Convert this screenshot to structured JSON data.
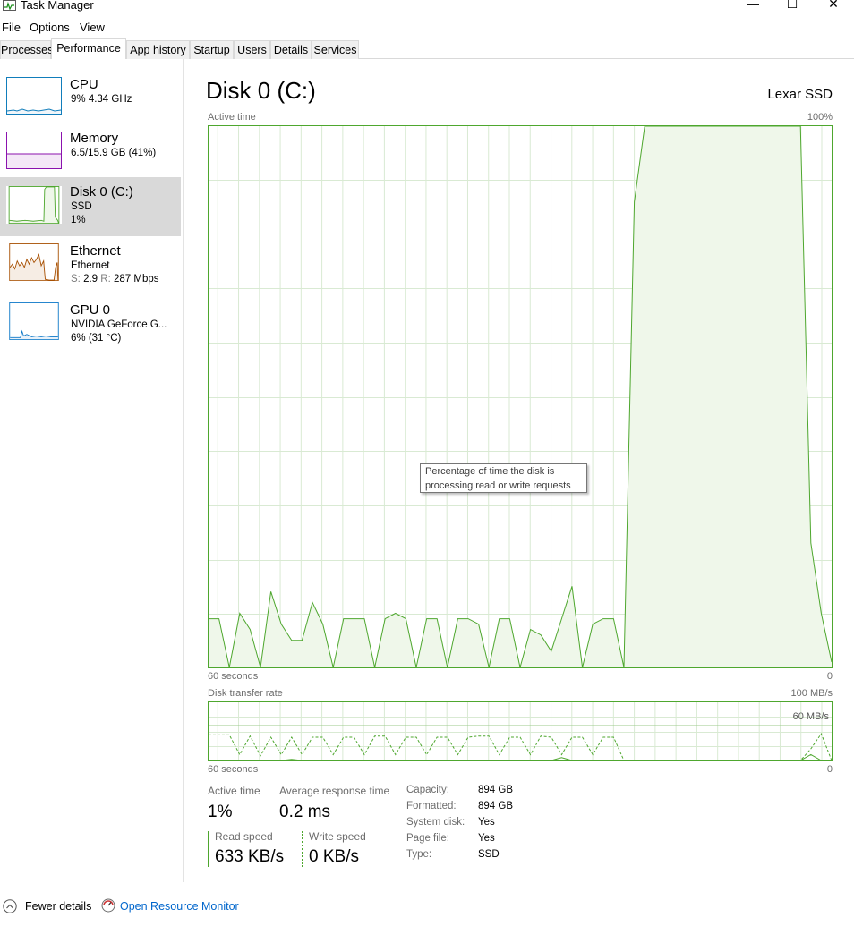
{
  "window": {
    "title": "Task Manager",
    "minimize": "—",
    "maximize": "☐",
    "close": "✕"
  },
  "menu": [
    "File",
    "Options",
    "View"
  ],
  "tabs": [
    "Processes",
    "Performance",
    "App history",
    "Startup",
    "Users",
    "Details",
    "Services"
  ],
  "active_tab": "Performance",
  "sidebar": {
    "items": [
      {
        "name": "CPU",
        "line1": "9%  4.34 GHz",
        "line2": ""
      },
      {
        "name": "Memory",
        "line1": "6.5/15.9 GB (41%)",
        "line2": ""
      },
      {
        "name": "Disk 0 (C:)",
        "line1": "SSD",
        "line2": "1%"
      },
      {
        "name": "Ethernet",
        "line1": "Ethernet",
        "line2_s_label": "S:",
        "line2_s_value": "2.9",
        "line2_r_label": "R:",
        "line2_r_value": "287 Mbps"
      },
      {
        "name": "GPU 0",
        "line1": "NVIDIA GeForce G...",
        "line2": "6%  (31 °C)"
      }
    ],
    "selected": "Disk 0 (C:)"
  },
  "main": {
    "title": "Disk 0 (C:)",
    "device_model": "Lexar SSD",
    "active_time_chart": {
      "label": "Active time",
      "max_label": "100%",
      "x_left_label": "60 seconds",
      "x_right_label": "0",
      "tooltip_line1": "Percentage of time the disk is",
      "tooltip_line2": "processing read or write requests"
    },
    "transfer_chart": {
      "label": "Disk transfer rate",
      "max_label": "100 MB/s",
      "ref_label": "60 MB/s",
      "x_left_label": "60 seconds",
      "x_right_label": "0"
    },
    "stats": {
      "active_time_label": "Active time",
      "active_time_value": "1%",
      "avg_response_label": "Average response time",
      "avg_response_value": "0.2 ms",
      "read_speed_label": "Read speed",
      "read_speed_value": "633 KB/s",
      "write_speed_label": "Write speed",
      "write_speed_value": "0 KB/s"
    },
    "properties": [
      {
        "key": "Capacity:",
        "value": "894 GB"
      },
      {
        "key": "Formatted:",
        "value": "894 GB"
      },
      {
        "key": "System disk:",
        "value": "Yes"
      },
      {
        "key": "Page file:",
        "value": "Yes"
      },
      {
        "key": "Type:",
        "value": "SSD"
      }
    ]
  },
  "footer": {
    "fewer_details": "Fewer details",
    "open_resource_monitor": "Open Resource Monitor"
  },
  "colors": {
    "disk_green": "#4ea72e",
    "disk_fill": "#eff7ea",
    "cpu_blue": "#117dbb",
    "memory_purple": "#8b12ae",
    "ethernet_orange": "#a74f01",
    "gpu_blue": "#0c78c8",
    "link_blue": "#0066cc"
  },
  "chart_data": [
    {
      "type": "area",
      "title": "Active time",
      "ylabel": "Active time (%)",
      "xlabel": "60 seconds",
      "ylim": [
        0,
        100
      ],
      "x": [
        60,
        59,
        58,
        57,
        56,
        55,
        54,
        53,
        52,
        51,
        50,
        49,
        48,
        47,
        46,
        45,
        44,
        43,
        42,
        41,
        40,
        39,
        38,
        37,
        36,
        35,
        34,
        33,
        32,
        31,
        30,
        29,
        28,
        27,
        26,
        25,
        24,
        23,
        22,
        21,
        20,
        19,
        18,
        17,
        16,
        15,
        14,
        13,
        12,
        11,
        10,
        9,
        8,
        7,
        6,
        5,
        4,
        3,
        2,
        1,
        0
      ],
      "series": [
        {
          "values": [
            9,
            9,
            0,
            10,
            7,
            0,
            14,
            8,
            5,
            5,
            12,
            8,
            0,
            9,
            9,
            9,
            0,
            9,
            10,
            9,
            0,
            9,
            9,
            0,
            9,
            9,
            8,
            0,
            9,
            9,
            0,
            7,
            6,
            3,
            9,
            15,
            0,
            8,
            9,
            9,
            0,
            86,
            100,
            100,
            100,
            100,
            100,
            100,
            100,
            100,
            100,
            100,
            100,
            100,
            100,
            100,
            100,
            100,
            23,
            10,
            1
          ],
          "color": "#4ea72e"
        }
      ]
    },
    {
      "type": "line",
      "title": "Disk transfer rate",
      "xlabel": "60 seconds",
      "ylim": [
        0,
        100
      ],
      "x": [
        60,
        59,
        58,
        57,
        56,
        55,
        54,
        53,
        52,
        51,
        50,
        49,
        48,
        47,
        46,
        45,
        44,
        43,
        42,
        41,
        40,
        39,
        38,
        37,
        36,
        35,
        34,
        33,
        32,
        31,
        30,
        29,
        28,
        27,
        26,
        25,
        24,
        23,
        22,
        21,
        20,
        19,
        18,
        17,
        16,
        15,
        14,
        13,
        12,
        11,
        10,
        9,
        8,
        7,
        6,
        5,
        4,
        3,
        2,
        1,
        0
      ],
      "series": [
        {
          "style": "dashed",
          "values": [
            44,
            44,
            44,
            10,
            42,
            8,
            40,
            10,
            40,
            10,
            40,
            40,
            10,
            40,
            40,
            10,
            42,
            42,
            10,
            40,
            40,
            10,
            40,
            40,
            10,
            40,
            42,
            42,
            10,
            40,
            40,
            10,
            42,
            40,
            10,
            40,
            40,
            10,
            40,
            40,
            0,
            0,
            0,
            0,
            0,
            0,
            0,
            0,
            0,
            0,
            0,
            0,
            0,
            0,
            0,
            0,
            0,
            0,
            20,
            46,
            0
          ],
          "color": "#4ea72e"
        },
        {
          "style": "solid",
          "values": [
            0,
            0,
            0,
            0,
            0,
            0,
            0,
            0,
            2,
            0,
            0,
            0,
            0,
            0,
            0,
            0,
            0,
            0,
            0,
            0,
            0,
            0,
            0,
            0,
            0,
            0,
            0,
            0,
            0,
            0,
            0,
            0,
            0,
            0,
            5,
            0,
            0,
            0,
            0,
            0,
            0,
            0,
            0,
            0,
            0,
            0,
            0,
            0,
            0,
            0,
            0,
            0,
            0,
            0,
            0,
            0,
            0,
            0,
            10,
            0,
            0
          ],
          "color": "#4ea72e"
        }
      ],
      "reference_line": 60
    }
  ]
}
